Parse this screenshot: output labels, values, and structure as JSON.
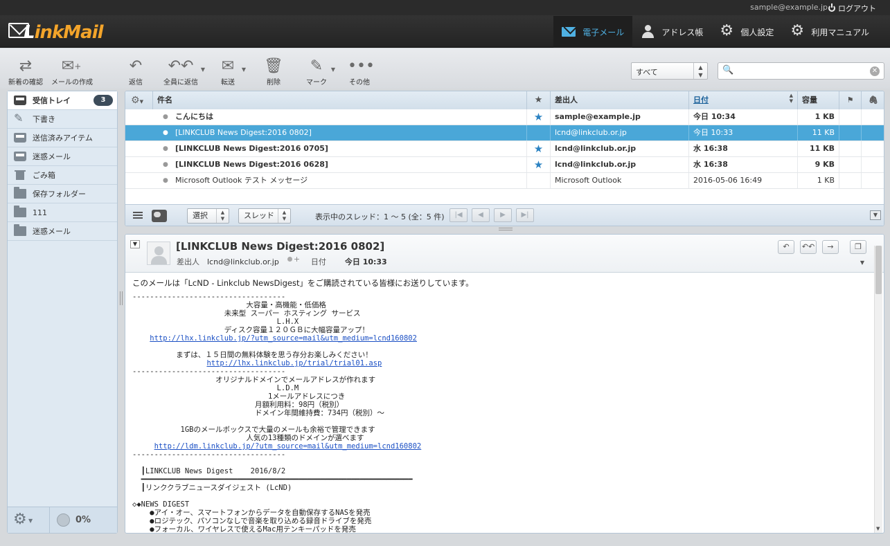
{
  "top": {
    "user_email": "sample@example.jp",
    "logout": "ログアウト"
  },
  "logo": {
    "text_l": "L",
    "text_rest": "inkMail"
  },
  "nav": [
    {
      "label": "電子メール",
      "icon": "mail-icon",
      "active": true
    },
    {
      "label": "アドレス帳",
      "icon": "person-icon"
    },
    {
      "label": "個人設定",
      "icon": "gear-icon"
    },
    {
      "label": "利用マニュアル",
      "icon": "help-gear-icon"
    }
  ],
  "toolbar": {
    "check_new": "新着の確認",
    "compose": "メールの作成",
    "reply": "返信",
    "reply_all": "全員に返信",
    "forward": "転送",
    "delete": "削除",
    "mark": "マーク",
    "more": "その他"
  },
  "filter": {
    "value": "すべて"
  },
  "search": {
    "placeholder": ""
  },
  "folders": [
    {
      "name": "受信トレイ",
      "icon": "inbox-icon",
      "count": "3",
      "active": true
    },
    {
      "name": "下書き",
      "icon": "pencil-icon"
    },
    {
      "name": "送信済みアイテム",
      "icon": "sent-icon"
    },
    {
      "name": "迷惑メール",
      "icon": "junk-icon"
    },
    {
      "name": "ごみ箱",
      "icon": "trash-icon"
    },
    {
      "name": "保存フォルダー",
      "icon": "folder-icon"
    },
    {
      "name": "111",
      "icon": "folder-icon"
    },
    {
      "name": "迷惑メール",
      "icon": "folder-icon"
    }
  ],
  "quota": {
    "percent": "0%"
  },
  "list": {
    "headers": {
      "subject": "件名",
      "from": "差出人",
      "date": "日付",
      "size": "容量"
    },
    "rows": [
      {
        "subject": "こんにちは",
        "from": "sample@example.jp",
        "date": "今日 10:34",
        "size": "1 KB",
        "flagged": true,
        "unread": true,
        "selected": false
      },
      {
        "subject": "[LINKCLUB News Digest:2016 0802]",
        "from": "lcnd@linkclub.or.jp",
        "date": "今日 10:33",
        "size": "11 KB",
        "flagged": false,
        "unread": false,
        "selected": true
      },
      {
        "subject": "[LINKCLUB News Digest:2016 0705]",
        "from": "lcnd@linkclub.or.jp",
        "date": "水 16:38",
        "size": "11 KB",
        "flagged": true,
        "unread": true,
        "selected": false
      },
      {
        "subject": "[LINKCLUB News Digest:2016 0628]",
        "from": "lcnd@linkclub.or.jp",
        "date": "水 16:38",
        "size": "9 KB",
        "flagged": true,
        "unread": true,
        "selected": false
      },
      {
        "subject": "Microsoft Outlook テスト メッセージ",
        "from": "Microsoft Outlook",
        "date": "2016-05-06 16:49",
        "size": "1 KB",
        "flagged": false,
        "unread": false,
        "selected": false
      }
    ],
    "select_label": "選択",
    "thread_label": "スレッド",
    "thread_info": "表示中のスレッド：1 ～ 5 (全：5 件)"
  },
  "preview": {
    "subject": "[LINKCLUB News Digest:2016 0802]",
    "from_label": "差出人",
    "from": "lcnd@linkclub.or.jp",
    "date_label": "日付",
    "date": "今日 10:33",
    "intro": "このメールは「LcND - Linkclub NewsDigest」をご購読されている皆様にお送りしています。",
    "body": [
      {
        "t": "-----------------------------------"
      },
      {
        "t": "                          大容量・高機能・低価格"
      },
      {
        "t": "                     未来型 スーパー ホスティング サービス"
      },
      {
        "t": "                                 L.H.X"
      },
      {
        "t": "                     ディスク容量１２０ＧＢに大幅容量アップ！"
      },
      {
        "t": "    ",
        "link": "http://lhx.linkclub.jp/?utm_source=mail&utm_medium=lcnd160802"
      },
      {
        "t": ""
      },
      {
        "t": "          まずは、１５日間の無料体験を思う存分お楽しみください！"
      },
      {
        "t": "                 ",
        "link": "http://lhx.linkclub.jp/trial/trial01.asp"
      },
      {
        "t": "-----------------------------------"
      },
      {
        "t": "                   オリジナルドメインでメールアドレスが作れます"
      },
      {
        "t": "                                 L.D.M"
      },
      {
        "t": "                               1メールアドレスにつき"
      },
      {
        "t": "                            月額利用料：98円（税別）"
      },
      {
        "t": "                            ドメイン年間維持費：734円（税別）～"
      },
      {
        "t": ""
      },
      {
        "t": "           1GBのメールボックスで大量のメールも余裕で管理できます"
      },
      {
        "t": "                          人気の13種類のドメインが選べます"
      },
      {
        "t": "     ",
        "link": "http://ldm.linkclub.jp/?utm_source=mail&utm_medium=lcnd160802"
      },
      {
        "t": "-----------------------------------"
      },
      {
        "t": ""
      },
      {
        "t": "  ┃LINKCLUB News Digest    2016/8/2"
      },
      {
        "t": "  ━━━━━━━━━━━━━━━━━━━━━━━━━━━━━━━━━━━━━━━━━━━━━━━━━━━━━━━━━━━━━━"
      },
      {
        "t": "  ┃リンククラブニュースダイジェスト (LcND)"
      },
      {
        "t": ""
      },
      {
        "t": "◇◆NEWS DIGEST"
      },
      {
        "t": "    ●アイ・オー、スマートフォンからデータを自動保存するNASを発売"
      },
      {
        "t": "    ●ロジテック、パソコンなしで音楽を取り込める録音ドライブを発売"
      },
      {
        "t": "    ●フォーカル、ワイヤレスで使えるMac用テンキーパッドを発売"
      }
    ]
  }
}
